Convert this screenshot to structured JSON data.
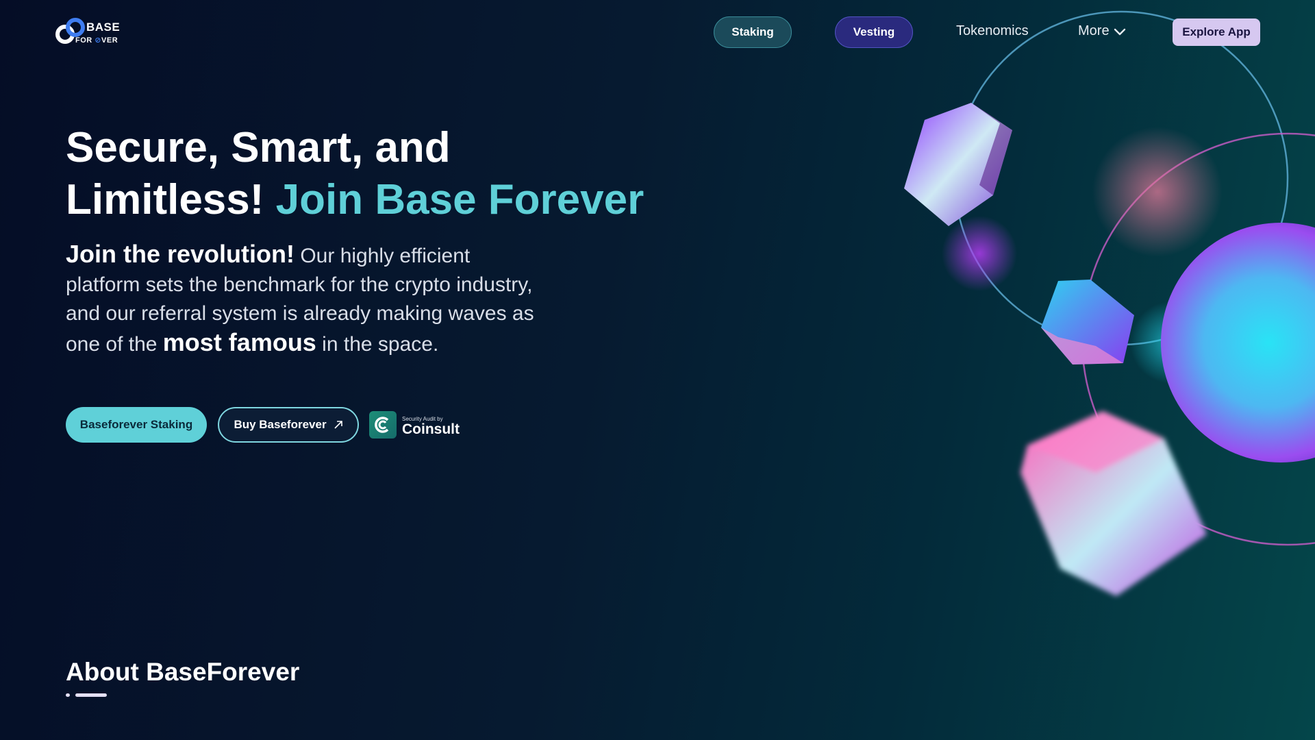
{
  "logo": {
    "line1": "BASE",
    "line2": "FOR",
    "line3": "VER",
    "icon": "infinity-logo-icon"
  },
  "nav": {
    "staking": "Staking",
    "vesting": "Vesting",
    "tokenomics": "Tokenomics",
    "more": "More",
    "more_icon": "chevron-down-icon",
    "explore": "Explore App"
  },
  "hero": {
    "title_line1": "Secure, Smart, and",
    "title_line2_plain": "Limitless!",
    "title_line2_accent": "Join Base Forever",
    "text_lead": "Join the revolution!",
    "text_part1": " Our highly efficient platform sets the benchmark for the crypto industry, and our referral system is already making waves as one of the ",
    "text_bold": "most famous",
    "text_part2": " in the space.",
    "btn_staking": "Baseforever Staking",
    "btn_buy": "Buy Baseforever",
    "btn_buy_icon": "arrow-up-right-icon",
    "audit_caption": "Security Audit by",
    "audit_name": "Coinsult",
    "audit_icon": "coinsult-logo-icon"
  },
  "about": {
    "title": "About BaseForever"
  },
  "colors": {
    "accent": "#5fd0d8",
    "staking_pill": "#1b4a5a",
    "vesting_pill": "#2a2a7e",
    "explore_button": "#d6c8f0",
    "background_dark": "#050d26",
    "background_teal": "#04464a"
  }
}
